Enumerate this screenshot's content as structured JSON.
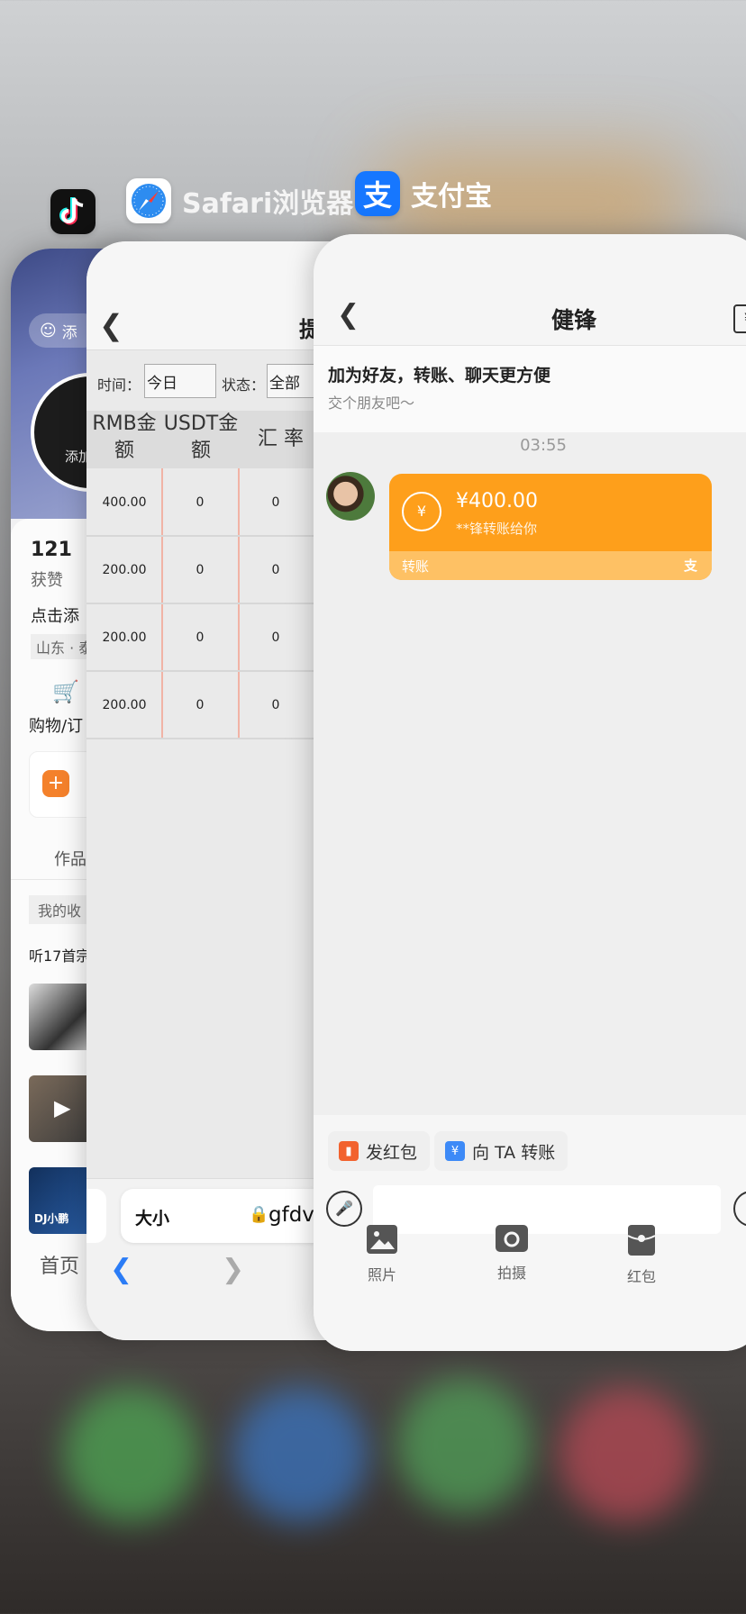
{
  "apps": {
    "douyin": {
      "icon": "douyin-icon"
    },
    "safari": {
      "name": "Safari浏览器",
      "icon": "safari-compass-icon"
    },
    "alipay": {
      "name": "支付宝",
      "icon": "alipay-icon",
      "icon_glyph": "支",
      "brand_color": "#1677ff"
    }
  },
  "douyin_card": {
    "add_button": "添",
    "avatar_text": "添加",
    "likes_count": "121",
    "likes_label": "获赞",
    "bio_prompt": "点击添",
    "location": "山东 · 泰",
    "shop_label": "购物/订",
    "works_tab": "作品",
    "favorites_label": "我的收",
    "playlist_title": "听17首宗",
    "thumb_text": "DJ小鹏",
    "home_tab": "首页"
  },
  "safari_card": {
    "page_title": "提",
    "filter_time_label": "时间：",
    "filter_time_value": "今日",
    "filter_status_label": "状态：",
    "filter_status_value": "全部",
    "columns": [
      {
        "line1": "RMB金",
        "line2": "额"
      },
      {
        "line1": "USDT金",
        "line2": "额"
      },
      {
        "line1": "汇 率",
        "line2": ""
      }
    ],
    "rows": [
      [
        "400.00",
        "0",
        "0"
      ],
      [
        "200.00",
        "0",
        "0"
      ],
      [
        "200.00",
        "0",
        "0"
      ],
      [
        "200.00",
        "0",
        "0"
      ]
    ],
    "text_size_button": "大小",
    "address": "gfdvi",
    "accent_color": "#2b7cf6"
  },
  "alipay_card": {
    "contact_name": "健锋",
    "banner_title": "加为好友，转账、聊天更方便",
    "banner_subtitle": "交个朋友吧～",
    "message_time": "03:55",
    "transfer": {
      "amount": "¥400.00",
      "note": "**锋转账给你",
      "footer_label": "转账",
      "footer_logo": "支",
      "color": "#fe9f1b"
    },
    "chips": [
      {
        "label": "发红包",
        "icon": "red-packet-icon",
        "color": "#f2622e"
      },
      {
        "label": "向 TA 转账",
        "icon": "transfer-icon",
        "color": "#3d8af7"
      }
    ],
    "tools": [
      {
        "label": "照片",
        "icon": "photo-icon"
      },
      {
        "label": "拍摄",
        "icon": "camera-icon"
      },
      {
        "label": "红包",
        "icon": "red-packet-icon"
      }
    ]
  }
}
